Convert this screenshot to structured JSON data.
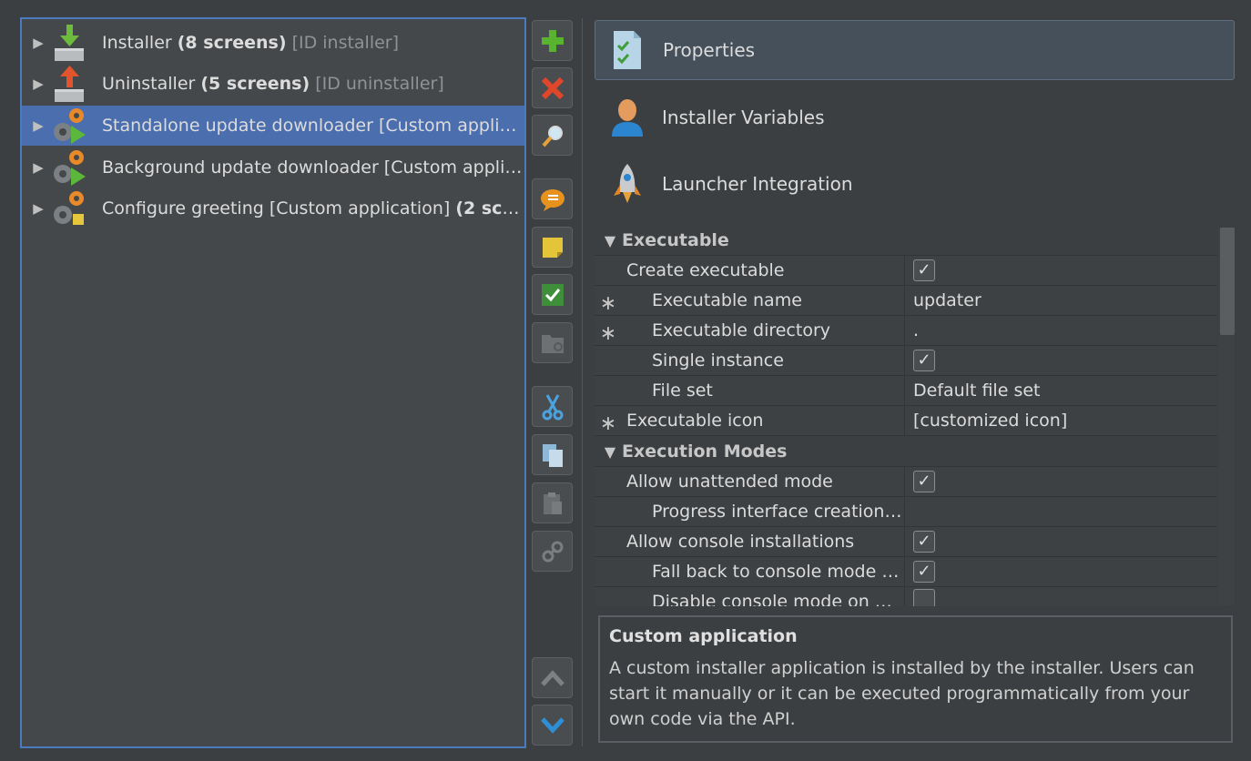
{
  "tree": {
    "items": [
      {
        "name": "Installer",
        "count": "(8 screens)",
        "meta": "[ID installer]",
        "icon": "installer-icon"
      },
      {
        "name": "Uninstaller",
        "count": "(5 screens)",
        "meta": "[ID uninstaller]",
        "icon": "uninstaller-icon"
      },
      {
        "name": "Standalone update downloader [Custom applica...",
        "count": "",
        "meta": "",
        "icon": "custom-application-icon"
      },
      {
        "name": "Background update downloader [Custom applic...",
        "count": "",
        "meta": "",
        "icon": "custom-application-icon"
      },
      {
        "name": "Configure greeting [Custom application]",
        "count": "(2 scre...",
        "meta": "",
        "icon": "custom-application-icon"
      }
    ],
    "selected_index": 2
  },
  "toolbar": {
    "buttons": [
      "add-icon",
      "delete-icon",
      "search-icon",
      "comment-icon",
      "note-icon",
      "check-icon",
      "folder-icon",
      "cut-icon",
      "copy-icon",
      "paste-icon",
      "link-icon",
      "move-up-icon",
      "move-down-icon"
    ]
  },
  "sections": [
    {
      "label": "Properties",
      "icon": "properties-icon",
      "active": true
    },
    {
      "label": "Installer Variables",
      "icon": "user-icon",
      "active": false
    },
    {
      "label": "Launcher Integration",
      "icon": "rocket-icon",
      "active": false
    }
  ],
  "properties": {
    "groups": {
      "executable": "Executable",
      "execution_modes": "Execution Modes"
    },
    "rows": {
      "create_executable": {
        "name": "Create executable",
        "value": ""
      },
      "executable_name": {
        "name": "Executable name",
        "value": "updater"
      },
      "executable_directory": {
        "name": "Executable directory",
        "value": "."
      },
      "single_instance": {
        "name": "Single instance",
        "value": ""
      },
      "file_set": {
        "name": "File set",
        "value": "Default file set"
      },
      "executable_icon": {
        "name": "Executable icon",
        "value": "[customized icon]"
      },
      "allow_unattended": {
        "name": "Allow unattended mode",
        "value": ""
      },
      "progress_interface": {
        "name": "Progress interface creation ...",
        "value": ""
      },
      "allow_console": {
        "name": "Allow console installations",
        "value": ""
      },
      "fall_back_console": {
        "name": "Fall back to console mode o...",
        "value": ""
      },
      "disable_console": {
        "name": "Disable console mode on W...",
        "value": ""
      }
    },
    "required_mark": "∗",
    "check_glyph": "✓"
  },
  "description": {
    "title": "Custom application",
    "text": "A custom installer application is installed by the installer. Users can start it manually or it can be executed programmatically from your own code via the API."
  },
  "colors": {
    "selection": "#4b6eaf",
    "tree_border": "#4a7bbf",
    "background": "#3c3f41"
  }
}
